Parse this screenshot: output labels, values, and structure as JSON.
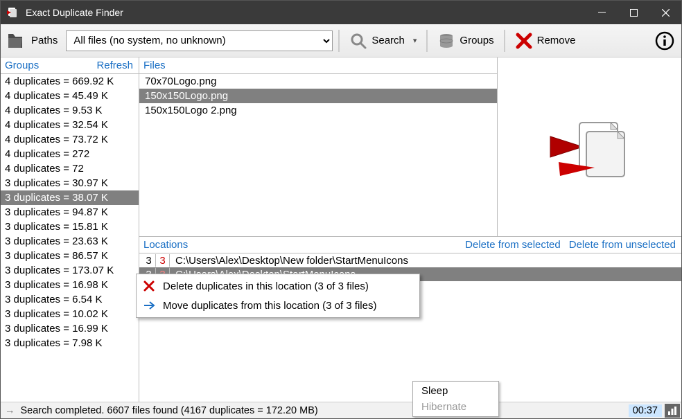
{
  "titlebar": {
    "title": "Exact Duplicate Finder"
  },
  "toolbar": {
    "paths_label": "Paths",
    "filter_selected": "All files (no system, no unknown)",
    "search_label": "Search",
    "groups_label": "Groups",
    "remove_label": "Remove"
  },
  "groups": {
    "header": "Groups",
    "refresh_label": "Refresh",
    "selected_index": 8,
    "items": [
      "4 duplicates = 669.92 K",
      "4 duplicates = 45.49 K",
      "4 duplicates = 9.53 K",
      "4 duplicates = 32.54 K",
      "4 duplicates = 73.72 K",
      "4 duplicates = 272",
      "4 duplicates = 72",
      "3 duplicates = 30.97 K",
      "3 duplicates = 38.07 K",
      "3 duplicates = 94.87 K",
      "3 duplicates = 15.81 K",
      "3 duplicates = 23.63 K",
      "3 duplicates = 86.57 K",
      "3 duplicates = 173.07 K",
      "3 duplicates = 16.98 K",
      "3 duplicates = 6.54 K",
      "3 duplicates = 10.02 K",
      "3 duplicates = 16.99 K",
      "3 duplicates = 7.98 K"
    ]
  },
  "files": {
    "header": "Files",
    "selected_index": 1,
    "items": [
      "70x70Logo.png",
      "150x150Logo.png",
      "150x150Logo 2.png"
    ]
  },
  "locations": {
    "header": "Locations",
    "delete_selected_label": "Delete from selected",
    "delete_unselected_label": "Delete from unselected",
    "selected_index": 1,
    "rows": [
      {
        "total": "3",
        "dup": "3",
        "path": "C:\\Users\\Alex\\Desktop\\New folder\\StartMenuIcons"
      },
      {
        "total": "3",
        "dup": "3",
        "path": "C:\\Users\\Alex\\Desktop\\StartMenuIcons"
      }
    ],
    "context_menu": {
      "delete_label": "Delete duplicates in this location (3 of 3 files)",
      "move_label": "Move duplicates from this location (3 of 3 files)"
    }
  },
  "sleep_menu": {
    "sleep_label": "Sleep",
    "hibernate_label": "Hibernate"
  },
  "status": {
    "text": "Search completed. 6607 files found (4167 duplicates = 172.20 MB)",
    "time": "00:37"
  }
}
